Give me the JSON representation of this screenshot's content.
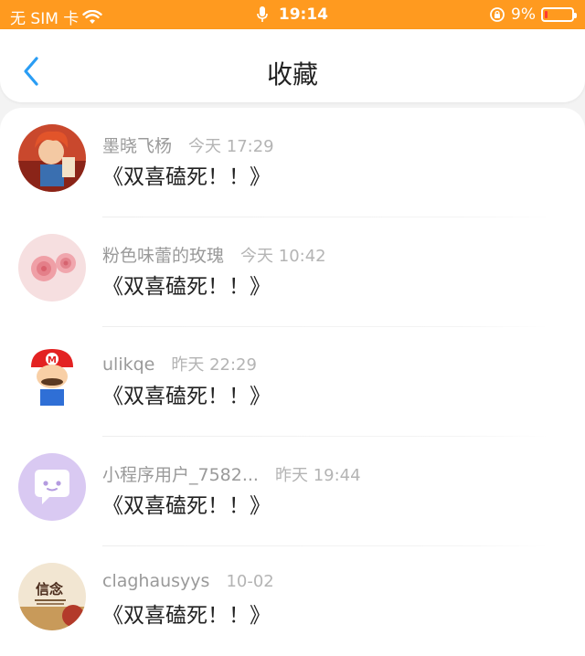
{
  "status_bar": {
    "carrier": "无 SIM 卡",
    "time": "19:14",
    "battery_percent": "9%",
    "battery_level": 0.09,
    "wifi_icon": "wifi-icon",
    "mic_icon": "mic-icon",
    "rotation_lock_icon": "rotation-lock-icon"
  },
  "header": {
    "title": "收藏",
    "back_icon": "chevron-left-icon"
  },
  "colors": {
    "status_bar_bg": "#ff9a1f",
    "back_arrow": "#2a9df4",
    "meta_text": "#9a9a9a",
    "title_text": "#222222"
  },
  "favorites": [
    {
      "user": "墨晓飞杨",
      "time": "今天 17:29",
      "title": "《双喜磕死！！》",
      "avatar": "cartoon-boy-avatar"
    },
    {
      "user": "粉色味蕾的玫瑰",
      "time": "今天 10:42",
      "title": "《双喜磕死！！》",
      "avatar": "pink-roses-avatar"
    },
    {
      "user": "ulikqe",
      "time": "昨天 22:29",
      "title": "《双喜磕死！！》",
      "avatar": "mario-avatar"
    },
    {
      "user": "小程序用户_7582...",
      "time": "昨天 19:44",
      "title": "《双喜磕死！！》",
      "avatar": "chat-bubble-avatar"
    },
    {
      "user": "claghausyys",
      "time": "10-02",
      "title": "《双喜磕死！！》",
      "avatar": "xinnian-text-avatar",
      "avatar_text": "信念"
    }
  ]
}
